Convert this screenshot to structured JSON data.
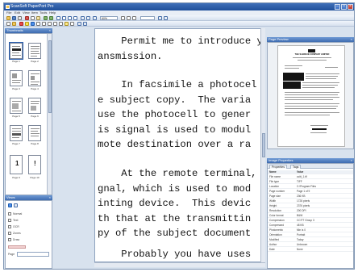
{
  "window": {
    "title": "ScanSoft PaperPort Pro"
  },
  "menu": [
    "File",
    "Edit",
    "View",
    "Item",
    "Tools",
    "Help"
  ],
  "toolbar": {
    "zoom": "60%"
  },
  "colors": {
    "titlebar": "#2f5fa8",
    "pane_header": "#4c79bd",
    "accent": "#3e6bb0",
    "panel_bg": "#d8e2ee"
  },
  "thumbnails_pane": {
    "title": "Thumbnails",
    "pages": [
      {
        "label": "Page 1",
        "badge": ""
      },
      {
        "label": "Page 2",
        "badge": ""
      },
      {
        "label": "Page 3",
        "badge": ""
      },
      {
        "label": "Page 4",
        "badge": ""
      },
      {
        "label": "Page 5",
        "badge": ""
      },
      {
        "label": "Page 6",
        "badge": ""
      },
      {
        "label": "Page 7",
        "badge": ""
      },
      {
        "label": "Page 8",
        "badge": ""
      },
      {
        "label": "Page 9",
        "badge": "1"
      },
      {
        "label": "Page 10",
        "badge": "!"
      }
    ]
  },
  "ocr_pane": {
    "title": "Views",
    "options": [
      "Normal",
      "Text",
      "OCR",
      "Zones",
      "Draw"
    ],
    "field_label": "Page"
  },
  "document_text": {
    "paragraphs": [
      [
        "    Permit me to introduce y",
        "ansmission."
      ],
      [
        "    In facsimile a photocel",
        "e subject copy.  The varia",
        "use the photocell to gener",
        "is signal is used to modul",
        "mote destination over a ra"
      ],
      [
        "    At the remote terminal,",
        "gnal, which is used to mod",
        "inting device.  This devic",
        "th that at the transmittin",
        "py of the subject document"
      ],
      [
        "    Probably you have uses"
      ]
    ]
  },
  "preview_pane": {
    "title": "Page Preview",
    "letterhead": "THE SLEREXE COMPANY LIMITED"
  },
  "properties_pane": {
    "title": "Image Properties",
    "tabs": [
      "Properties",
      "Tags"
    ],
    "header": {
      "key": "Name",
      "value": "Value"
    },
    "rows": [
      {
        "key": "File name",
        "value": "ccitt_1.tif"
      },
      {
        "key": "File type",
        "value": "TIFF"
      },
      {
        "key": "Location",
        "value": "C:\\Program Files"
      },
      {
        "key": "Page number",
        "value": "Page 1 of 9"
      },
      {
        "key": "Page size",
        "value": "236 KB"
      },
      {
        "key": "Width",
        "value": "1728 pixels"
      },
      {
        "key": "Height",
        "value": "2376 pixels"
      },
      {
        "key": "Resolution",
        "value": "200 DPI"
      },
      {
        "key": "Color format",
        "value": "B&W"
      },
      {
        "key": "Compression",
        "value": "CCITT Group 3"
      },
      {
        "key": "Compressed",
        "value": "48 KB"
      },
      {
        "key": "Photometric",
        "value": "Min is 0"
      },
      {
        "key": "Orientation",
        "value": "Portrait"
      },
      {
        "key": "Modified",
        "value": "Today"
      },
      {
        "key": "Author",
        "value": "Unknown"
      },
      {
        "key": "Date",
        "value": "None"
      }
    ]
  }
}
